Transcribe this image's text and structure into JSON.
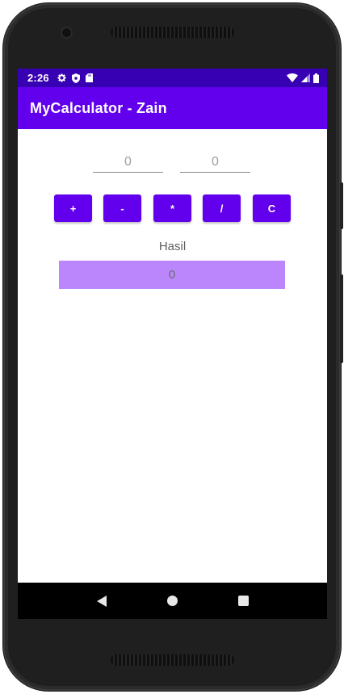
{
  "status_bar": {
    "time": "2:26",
    "left_icons": [
      "gear-icon",
      "shield-icon",
      "sd-card-icon"
    ],
    "right_icons": [
      "wifi-icon",
      "signal-icon",
      "battery-icon"
    ]
  },
  "app_bar": {
    "title": "MyCalculator - Zain"
  },
  "inputs": {
    "first_placeholder": "0",
    "second_placeholder": "0"
  },
  "buttons": {
    "add": "+",
    "subtract": "-",
    "multiply": "*",
    "divide": "/",
    "clear": "C"
  },
  "result": {
    "label": "Hasil",
    "value": "0"
  },
  "colors": {
    "primary": "#6200ee",
    "primary_dark": "#3700b3",
    "result_background": "#bb86fc"
  },
  "nav_bar": {
    "icons": [
      "back-icon",
      "home-icon",
      "recents-icon"
    ]
  }
}
